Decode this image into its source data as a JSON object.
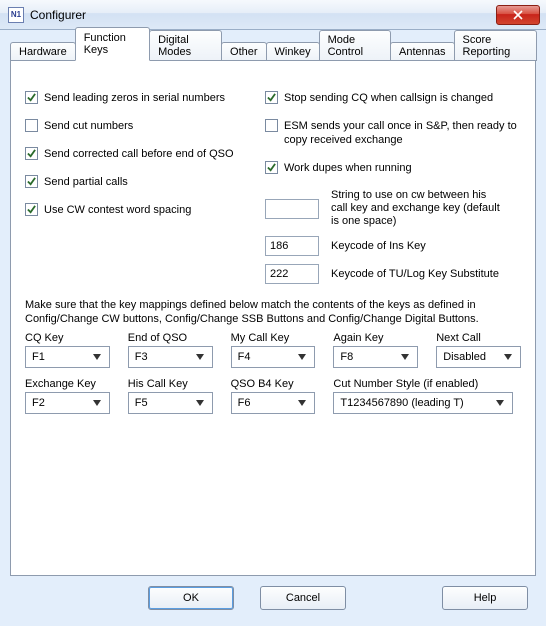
{
  "window": {
    "title": "Configurer",
    "app_icon_label": "N1"
  },
  "tabs": [
    "Hardware",
    "Function Keys",
    "Digital Modes",
    "Other",
    "Winkey",
    "Mode Control",
    "Antennas",
    "Score Reporting"
  ],
  "active_tab_index": 1,
  "checkboxes_left": [
    {
      "label": "Send leading zeros in serial numbers",
      "checked": true
    },
    {
      "label": "Send cut numbers",
      "checked": false
    },
    {
      "label": "Send corrected call before end of QSO",
      "checked": true
    },
    {
      "label": "Send partial calls",
      "checked": true
    },
    {
      "label": "Use CW contest word spacing",
      "checked": true
    }
  ],
  "checkboxes_right": [
    {
      "label": "Stop sending CQ when callsign is changed",
      "checked": true
    },
    {
      "label": "ESM sends your call once in S&P, then ready to copy received exchange",
      "checked": false
    },
    {
      "label": "Work dupes when running",
      "checked": true
    }
  ],
  "fields": {
    "between_keys": {
      "value": "",
      "label": "String to use on cw between his call key and exchange key (default is one space)"
    },
    "ins_key": {
      "value": "186",
      "label": "Keycode of Ins Key"
    },
    "tu_key": {
      "value": "222",
      "label": "Keycode of TU/Log Key Substitute"
    }
  },
  "note": "Make sure that the key mappings defined below match the contents of the keys as defined in Config/Change CW buttons, Config/Change SSB Buttons and Config/Change Digital Buttons.",
  "key_grid_row1": [
    {
      "label": "CQ Key",
      "value": "F1"
    },
    {
      "label": "End of QSO",
      "value": "F3"
    },
    {
      "label": "My Call Key",
      "value": "F4"
    },
    {
      "label": "Again  Key",
      "value": "F8"
    },
    {
      "label": "Next Call",
      "value": "Disabled"
    }
  ],
  "key_grid_row2": [
    {
      "label": "Exchange  Key",
      "value": "F2"
    },
    {
      "label": "His Call Key",
      "value": "F5"
    },
    {
      "label": "QSO B4 Key",
      "value": "F6"
    }
  ],
  "cut_number_style": {
    "label": "Cut Number Style (if enabled)",
    "value": "T1234567890 (leading T)"
  },
  "buttons": {
    "ok": "OK",
    "cancel": "Cancel",
    "help": "Help"
  }
}
